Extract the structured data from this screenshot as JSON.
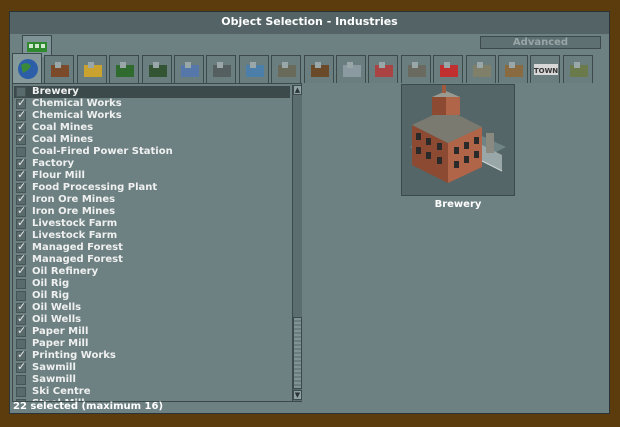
{
  "window": {
    "title": "Object Selection - Industries",
    "advanced_label": "Advanced"
  },
  "tabs": [
    {
      "name": "tab-industries",
      "icon": "industry-icon",
      "active": true
    },
    {
      "name": "tab-buildings",
      "icon": "buildings-icon"
    },
    {
      "name": "tab-climate",
      "icon": "sun-cloud-icon"
    },
    {
      "name": "tab-trees",
      "icon": "trees-icon"
    },
    {
      "name": "tab-vehicles",
      "icon": "steam-engine-icon"
    },
    {
      "name": "tab-airports",
      "icon": "airport-icon"
    },
    {
      "name": "tab-roads",
      "icon": "road-icon"
    },
    {
      "name": "tab-water",
      "icon": "water-icon"
    },
    {
      "name": "tab-road-vehicles",
      "icon": "road-vehicle-icon"
    },
    {
      "name": "tab-track",
      "icon": "track-icon"
    },
    {
      "name": "tab-signals",
      "icon": "gear-signal-icon"
    },
    {
      "name": "tab-people",
      "icon": "people-icon"
    },
    {
      "name": "tab-bridges",
      "icon": "bridge-icon"
    },
    {
      "name": "tab-crossing",
      "icon": "level-crossing-icon"
    },
    {
      "name": "tab-signal-posts",
      "icon": "signal-post-icon"
    },
    {
      "name": "tab-walls",
      "icon": "wall-icon"
    },
    {
      "name": "tab-town-names",
      "icon": "town-sign-icon",
      "label": "TOWN"
    },
    {
      "name": "tab-terrain",
      "icon": "terrain-icon"
    }
  ],
  "list": {
    "items": [
      {
        "label": "Brewery",
        "checked": false,
        "selected": true
      },
      {
        "label": "Chemical Works",
        "checked": true
      },
      {
        "label": "Chemical Works",
        "checked": true
      },
      {
        "label": "Coal Mines",
        "checked": true
      },
      {
        "label": "Coal Mines",
        "checked": true
      },
      {
        "label": "Coal-Fired Power Station",
        "checked": false
      },
      {
        "label": "Factory",
        "checked": true
      },
      {
        "label": "Flour Mill",
        "checked": true
      },
      {
        "label": "Food Processing Plant",
        "checked": true
      },
      {
        "label": "Iron Ore Mines",
        "checked": true
      },
      {
        "label": "Iron Ore Mines",
        "checked": true
      },
      {
        "label": "Livestock Farm",
        "checked": true
      },
      {
        "label": "Livestock Farm",
        "checked": true
      },
      {
        "label": "Managed Forest",
        "checked": true
      },
      {
        "label": "Managed Forest",
        "checked": true
      },
      {
        "label": "Oil Refinery",
        "checked": true
      },
      {
        "label": "Oil Rig",
        "checked": false
      },
      {
        "label": "Oil Rig",
        "checked": false
      },
      {
        "label": "Oil Wells",
        "checked": true
      },
      {
        "label": "Oil Wells",
        "checked": true
      },
      {
        "label": "Paper Mill",
        "checked": true
      },
      {
        "label": "Paper Mill",
        "checked": false
      },
      {
        "label": "Printing Works",
        "checked": true
      },
      {
        "label": "Sawmill",
        "checked": true
      },
      {
        "label": "Sawmill",
        "checked": false
      },
      {
        "label": "Ski Centre",
        "checked": false
      },
      {
        "label": "Steel Mill",
        "checked": false
      }
    ]
  },
  "preview": {
    "label": "Brewery"
  },
  "status": {
    "text": "22 selected (maximum 16)"
  },
  "colors": {
    "window": "#6d8183",
    "frame": "#5c3b0c",
    "selection": "#3c4a4c"
  }
}
